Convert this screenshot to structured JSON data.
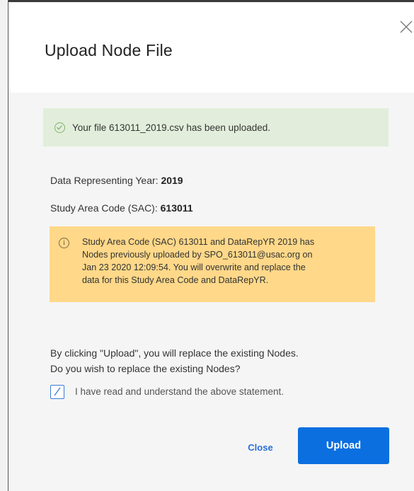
{
  "dialog": {
    "title": "Upload Node File",
    "close_icon": "close-icon"
  },
  "success": {
    "icon": "check-circle-icon",
    "message": "Your file 613011_2019.csv has been uploaded."
  },
  "details": {
    "year_label": "Data Representing Year:",
    "year_value": "2019",
    "sac_label": "Study Area Code (SAC):",
    "sac_value": "613011"
  },
  "warning": {
    "icon": "info-icon",
    "icon_glyph": "i",
    "line1": "Study Area Code (SAC) 613011 and DataRepYR 2019 has",
    "line2": "Nodes previously uploaded by SPO_613011@usac.org on",
    "line3": "Jan 23 2020 12:09:54. You will overwrite and replace the",
    "line4": "data for this Study Area Code and DataRepYR."
  },
  "confirm": {
    "line1": "By clicking \"Upload\", you will replace the existing Nodes.",
    "line2": "Do you wish to replace the existing Nodes?",
    "checkbox_checked": true,
    "checkbox_label": "I have read and understand the above statement."
  },
  "actions": {
    "close_label": "Close",
    "upload_label": "Upload"
  },
  "colors": {
    "success_bg": "#e2eedb",
    "warning_bg": "#ffd889",
    "primary": "#0b6fe0"
  }
}
